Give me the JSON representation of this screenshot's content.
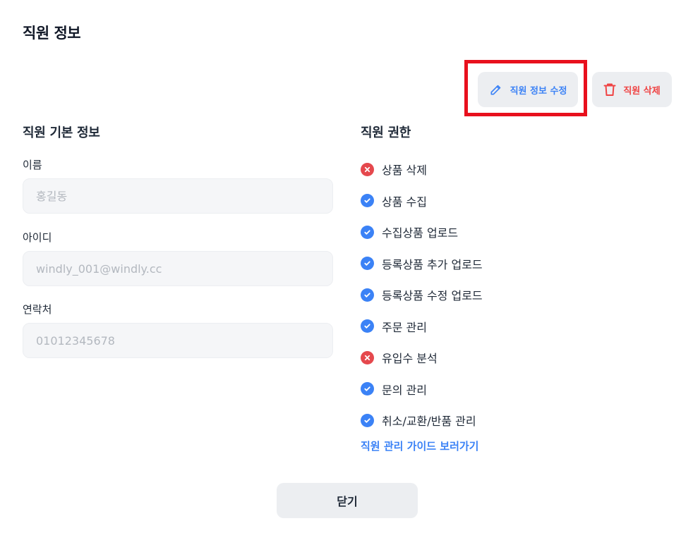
{
  "page": {
    "title": "직원 정보"
  },
  "actions": {
    "edit_label": "직원 정보 수정",
    "edit_icon": "pencil-icon",
    "delete_label": "직원 삭제",
    "delete_icon": "trash-icon",
    "highlight_color": "#e8101d"
  },
  "basic_info": {
    "title": "직원 기본 정보",
    "fields": [
      {
        "label": "이름",
        "placeholder": "홍길동",
        "value": ""
      },
      {
        "label": "아이디",
        "placeholder": "windly_001@windly.cc",
        "value": ""
      },
      {
        "label": "연락처",
        "placeholder": "01012345678",
        "value": ""
      }
    ]
  },
  "permissions": {
    "title": "직원 권한",
    "items": [
      {
        "label": "상품 삭제",
        "enabled": false,
        "icon": "x-circle-icon"
      },
      {
        "label": "상품 수집",
        "enabled": true,
        "icon": "check-circle-icon"
      },
      {
        "label": "수집상품 업로드",
        "enabled": true,
        "icon": "check-circle-icon"
      },
      {
        "label": "등록상품 추가 업로드",
        "enabled": true,
        "icon": "check-circle-icon"
      },
      {
        "label": "등록상품 수정 업로드",
        "enabled": true,
        "icon": "check-circle-icon"
      },
      {
        "label": "주문 관리",
        "enabled": true,
        "icon": "check-circle-icon"
      },
      {
        "label": "유입수 분석",
        "enabled": false,
        "icon": "x-circle-icon"
      },
      {
        "label": "문의 관리",
        "enabled": true,
        "icon": "check-circle-icon"
      },
      {
        "label": "취소/교환/반품 관리",
        "enabled": true,
        "icon": "check-circle-icon"
      }
    ],
    "guide_link": "직원 관리 가이드 보러가기"
  },
  "footer": {
    "close_label": "닫기"
  },
  "colors": {
    "accent_blue": "#3b82f6",
    "danger_red": "#e5484d",
    "button_bg": "#eceef1",
    "input_bg": "#f5f6f8"
  }
}
